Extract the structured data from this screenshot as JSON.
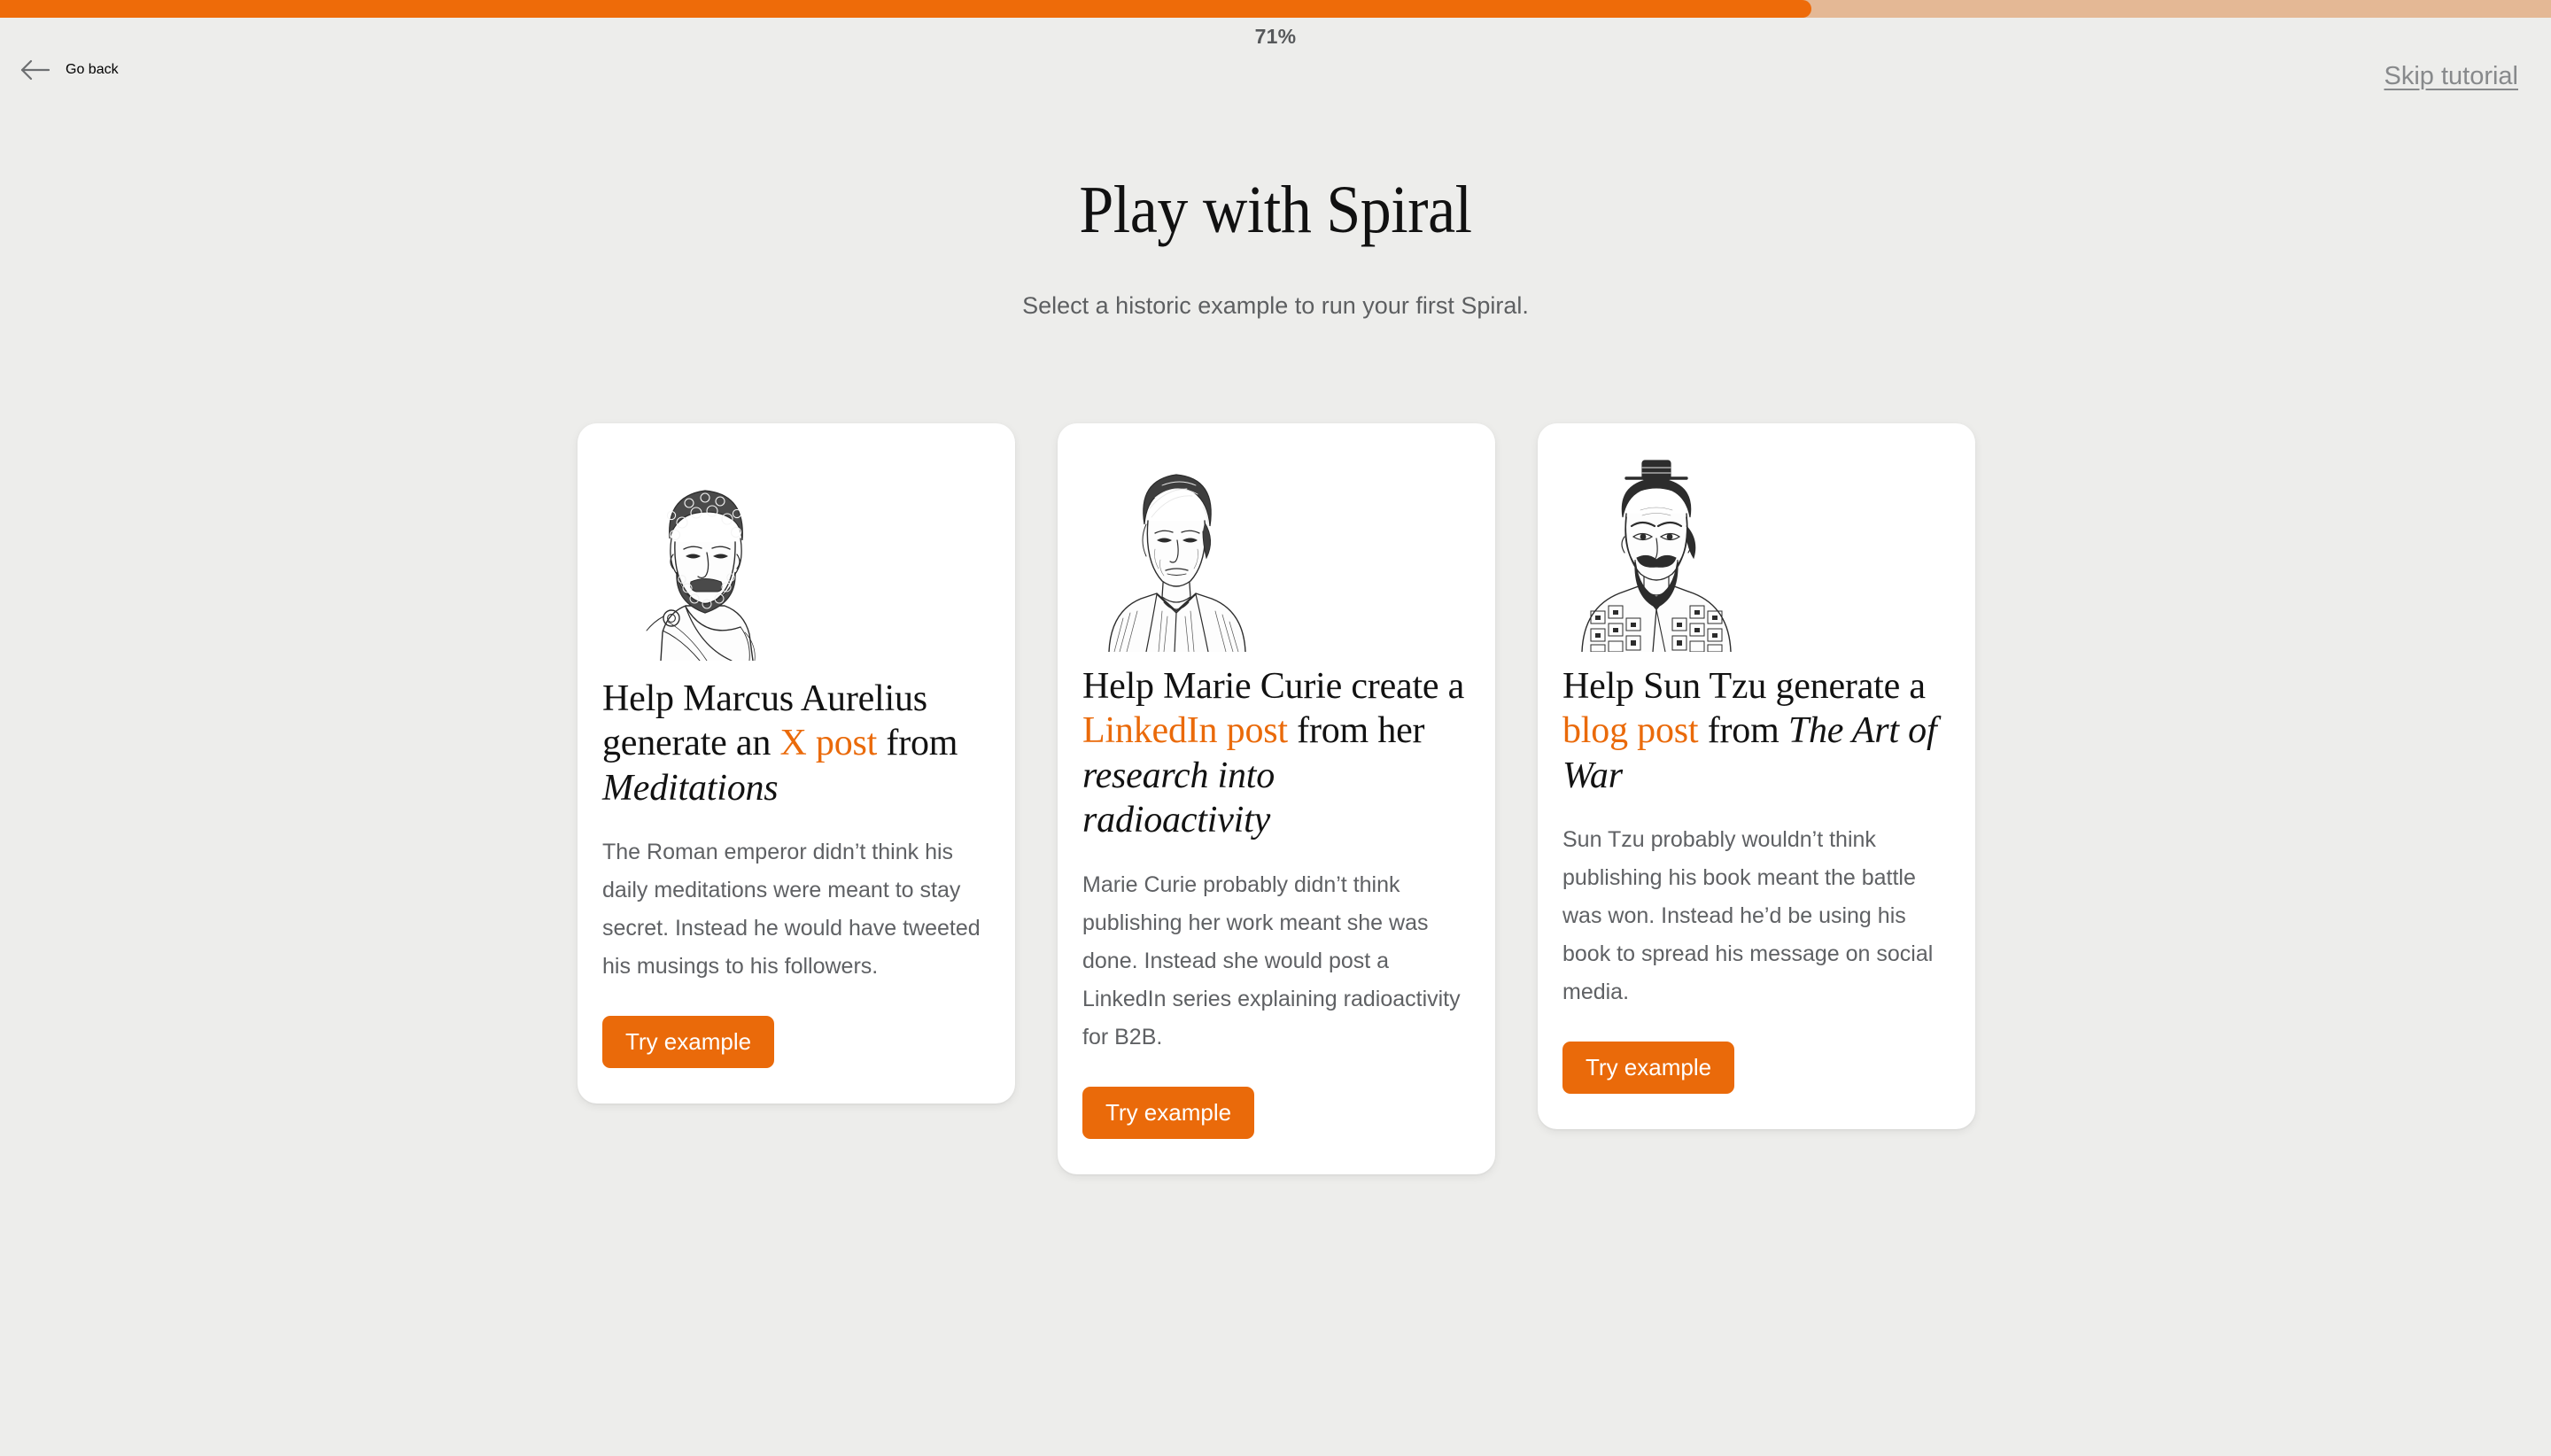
{
  "progress": {
    "percent_label": "71%",
    "percent_value": 71,
    "fill_color": "#ee6b09",
    "track_color": "#e4b895"
  },
  "header": {
    "back_label": "Go back",
    "back_icon": "arrow-left-icon",
    "skip_label": "Skip tutorial"
  },
  "hero": {
    "title": "Play with Spiral",
    "subtitle": "Select a historic example to run your first Spiral."
  },
  "theme": {
    "accent": "#ea6a0a",
    "background": "#ededeb",
    "card_background": "#ffffff",
    "body_text": "#5f6164",
    "heading_text": "#121212"
  },
  "cards": [
    {
      "portrait_icon": "marcus-aurelius-portrait",
      "heading": {
        "part1": "Help Marcus Aurelius generate an ",
        "highlight": "X post",
        "part2": " from ",
        "italic": "Meditations"
      },
      "body": "The Roman emperor didn’t think his daily meditations were meant to stay secret. Instead he would have tweeted his musings to his followers.",
      "button_label": "Try example"
    },
    {
      "portrait_icon": "marie-curie-portrait",
      "heading": {
        "part1": "Help Marie Curie create a ",
        "highlight": "LinkedIn post",
        "part2": " from her ",
        "italic": "research into radioactivity"
      },
      "body": "Marie Curie probably didn’t think publishing her work meant she was done. Instead she would post a LinkedIn series explaining radioactivity for B2B.",
      "button_label": "Try example"
    },
    {
      "portrait_icon": "sun-tzu-portrait",
      "heading": {
        "part1": "Help Sun Tzu generate a ",
        "highlight": "blog post",
        "part2": " from ",
        "italic": "The Art of War"
      },
      "body": "Sun Tzu probably wouldn’t think publishing his book meant the battle was won. Instead he’d be using his book to spread his message on social media.",
      "button_label": "Try example"
    }
  ]
}
